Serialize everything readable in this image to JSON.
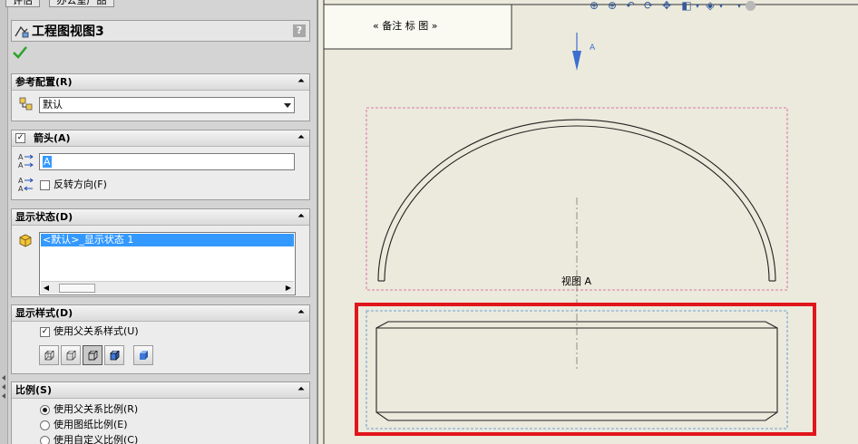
{
  "property_manager": {
    "top_tabs": [
      "评估",
      "办公室产品"
    ],
    "title": "工程图视图3",
    "help_label": "?",
    "sections": {
      "reference_config": {
        "title": "参考配置(R)",
        "selected": "默认"
      },
      "arrow": {
        "title": "箭头(A)",
        "checked": true,
        "label_value": "A",
        "reverse_direction": "反转方向(F)"
      },
      "display_state": {
        "title": "显示状态(D)",
        "item": "<默认>_显示状态 1"
      },
      "display_style": {
        "title": "显示样式(D)",
        "use_parent_style": "使用父关系样式(U)",
        "active_style_index": 2
      },
      "scale": {
        "title": "比例(S)",
        "options": [
          "使用父关系比例(R)",
          "使用图纸比例(E)",
          "使用自定义比例(C)"
        ],
        "selected_index": 0
      }
    }
  },
  "drawing": {
    "note_text": "« 备注 标 图 »",
    "section_arrow_label": "A",
    "view_label": "视图 A",
    "highlight_color": "#e1161c",
    "view_border_color": "#d9539a",
    "selected_view_border_color": "#4a88d8"
  },
  "icons": {
    "title": "drawing-view-icon",
    "ok": "check-icon",
    "config": "configuration-icon",
    "arrow_label": "label-icon",
    "reverse": "reverse-direction-icon",
    "display_state": "display-state-icon",
    "toolbar": [
      "zoom-to-fit-icon",
      "zoom-area-icon",
      "previous-view-icon",
      "rotate-icon",
      "pan-icon",
      "view-orientation-icon",
      "display-style-icon",
      "hide-show-icon",
      "appearance-icon"
    ]
  }
}
